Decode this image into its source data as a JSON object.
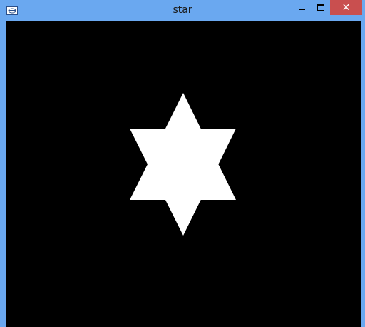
{
  "window": {
    "title": "star",
    "icon": "app-icon",
    "close_label": "✕",
    "colors": {
      "frame": "#6aa8f0",
      "close_button": "#c94f4f",
      "canvas_background": "#000000",
      "shape_fill": "#ffffff"
    }
  },
  "controls": {
    "minimize_icon": "minimize-icon",
    "maximize_icon": "maximize-icon",
    "close_icon": "close-icon"
  },
  "canvas": {
    "shape": "six-pointed-star"
  }
}
